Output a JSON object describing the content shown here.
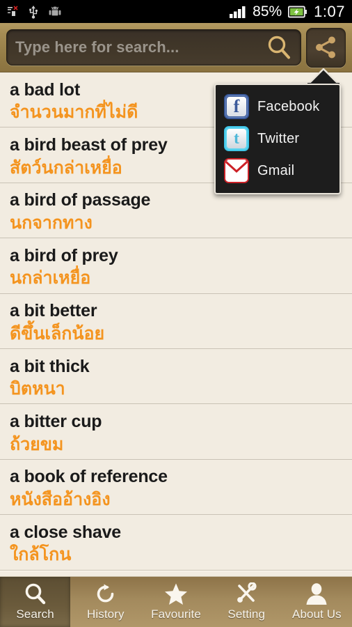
{
  "status_bar": {
    "icons_left": [
      "sim-error-icon",
      "usb-icon",
      "android-debug-icon"
    ],
    "signal_icon": "signal-bars-icon",
    "battery_percent": "85%",
    "battery_icon": "battery-charging-icon",
    "time": "1:07"
  },
  "toolbar": {
    "search_placeholder": "Type here for search...",
    "search_value": "",
    "search_icon": "search-icon",
    "share_icon": "share-icon"
  },
  "share_popup": {
    "visible": true,
    "items": [
      {
        "label": "Facebook",
        "icon": "facebook-icon",
        "glyph": "f",
        "color": "#3b5a9b"
      },
      {
        "label": "Twitter",
        "icon": "twitter-icon",
        "glyph": "t",
        "color": "#4fb8d8"
      },
      {
        "label": "Gmail",
        "icon": "gmail-icon",
        "glyph": "",
        "color": "#cc2127"
      }
    ]
  },
  "entries": [
    {
      "en": "a bad lot",
      "th": "จำนวนมากที่ไม่ดี"
    },
    {
      "en": "a bird beast of prey",
      "th": "สัตว์นกล่าเหยื่อ"
    },
    {
      "en": "a bird of passage",
      "th": "นกจากทาง"
    },
    {
      "en": "a bird of prey",
      "th": "นกล่าเหยื่อ"
    },
    {
      "en": "a bit better",
      "th": "ดีขึ้นเล็กน้อย"
    },
    {
      "en": "a bit thick",
      "th": "บิตหนา"
    },
    {
      "en": "a bitter cup",
      "th": "ถ้วยขม"
    },
    {
      "en": "a book of reference",
      "th": "หนังสืออ้างอิง"
    },
    {
      "en": "a close shave",
      "th": "ใกล้โกน"
    }
  ],
  "bottom_nav": {
    "items": [
      {
        "label": "Search",
        "icon": "search-icon",
        "active": true
      },
      {
        "label": "History",
        "icon": "refresh-icon",
        "active": false
      },
      {
        "label": "Favourite",
        "icon": "star-icon",
        "active": false
      },
      {
        "label": "Setting",
        "icon": "tools-icon",
        "active": false
      },
      {
        "label": "About Us",
        "icon": "person-icon",
        "active": false
      }
    ]
  },
  "colors": {
    "accent_orange": "#f4941f",
    "toolbar_brown": "#a58c54",
    "list_bg": "#f2ece1",
    "popup_bg": "#1d1d1d"
  }
}
